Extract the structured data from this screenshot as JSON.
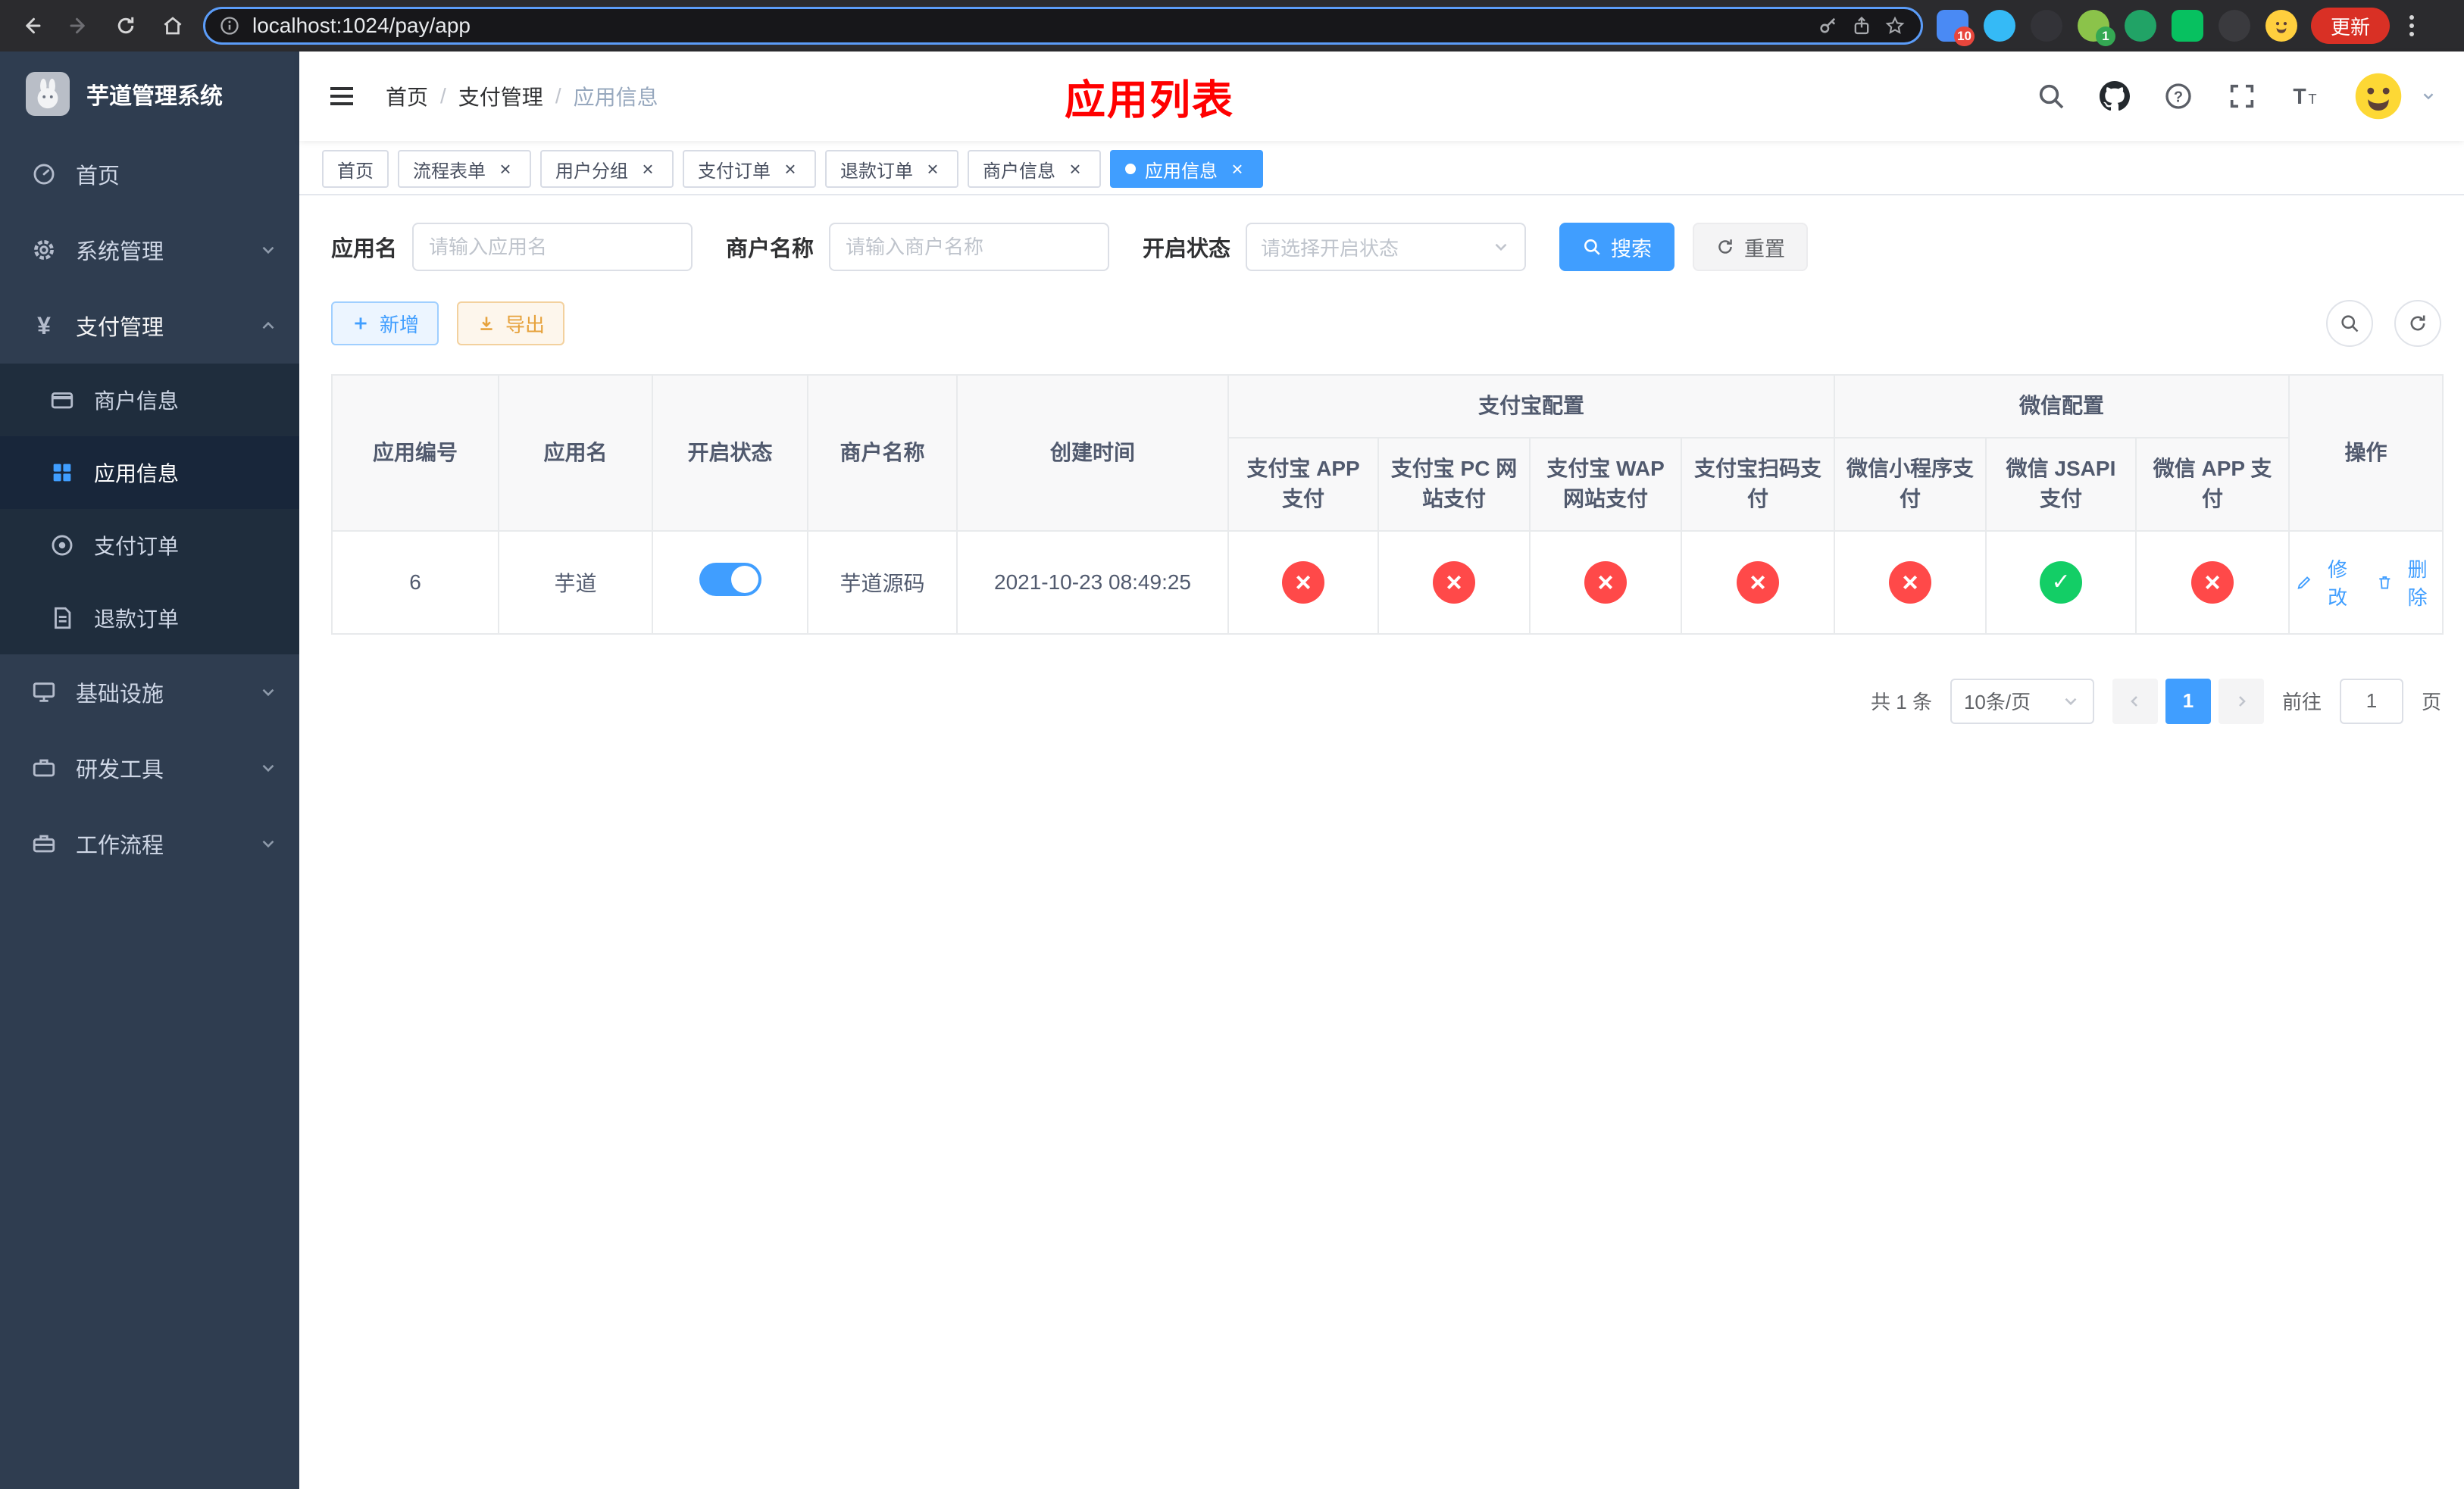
{
  "theme": {
    "accent": "#409eff",
    "danger": "#ff4949",
    "success": "#13ce66",
    "warning": "#e6a23c",
    "titlered": "#ff0000"
  },
  "browser": {
    "url": "localhost:1024/pay/app",
    "update_label": "更新",
    "extension_badge_blue": "10",
    "extension_badge_green": "1"
  },
  "sidebar": {
    "title": "芋道管理系统",
    "items": [
      {
        "label": "首页"
      },
      {
        "label": "系统管理"
      },
      {
        "label": "支付管理"
      },
      {
        "label": "基础设施"
      },
      {
        "label": "研发工具"
      },
      {
        "label": "工作流程"
      }
    ],
    "payment_children": [
      {
        "label": "商户信息"
      },
      {
        "label": "应用信息"
      },
      {
        "label": "支付订单"
      },
      {
        "label": "退款订单"
      }
    ]
  },
  "header": {
    "breadcrumb": [
      {
        "label": "首页"
      },
      {
        "label": "支付管理"
      },
      {
        "label": "应用信息"
      }
    ],
    "title": "应用列表"
  },
  "tabs": [
    {
      "label": "首页"
    },
    {
      "label": "流程表单"
    },
    {
      "label": "用户分组"
    },
    {
      "label": "支付订单"
    },
    {
      "label": "退款订单"
    },
    {
      "label": "商户信息"
    },
    {
      "label": "应用信息"
    }
  ],
  "filters": {
    "app_name_label": "应用名",
    "app_name_placeholder": "请输入应用名",
    "merchant_name_label": "商户名称",
    "merchant_name_placeholder": "请输入商户名称",
    "status_label": "开启状态",
    "status_placeholder": "请选择开启状态",
    "search_button": "搜索",
    "reset_button": "重置"
  },
  "toolbar": {
    "add_button": "新增",
    "export_button": "导出"
  },
  "table": {
    "col_id": "应用编号",
    "col_name": "应用名",
    "col_status": "开启状态",
    "col_merchant": "商户名称",
    "col_created": "创建时间",
    "group_alipay": "支付宝配置",
    "group_wechat": "微信配置",
    "col_alipay_app": "支付宝 APP 支付",
    "col_alipay_pc": "支付宝 PC 网站支付",
    "col_alipay_wap": "支付宝 WAP 网站支付",
    "col_alipay_qr": "支付宝扫码支付",
    "col_wx_mini": "微信小程序支付",
    "col_wx_jsapi": "微信 JSAPI 支付",
    "col_wx_app": "微信 APP 支付",
    "col_ops": "操作",
    "rows": [
      {
        "id": "6",
        "name": "芋道",
        "status": "on",
        "merchant": "芋道源码",
        "created": "2021-10-23 08:49:25",
        "configs": [
          "no",
          "no",
          "no",
          "no",
          "no",
          "yes",
          "no"
        ],
        "edit_label": "修改",
        "delete_label": "删除"
      }
    ]
  },
  "pagination": {
    "total": "共 1 条",
    "page_size": "10条/页",
    "page": "1",
    "goto_prefix": "前往",
    "goto_value": "1",
    "goto_suffix": "页"
  }
}
